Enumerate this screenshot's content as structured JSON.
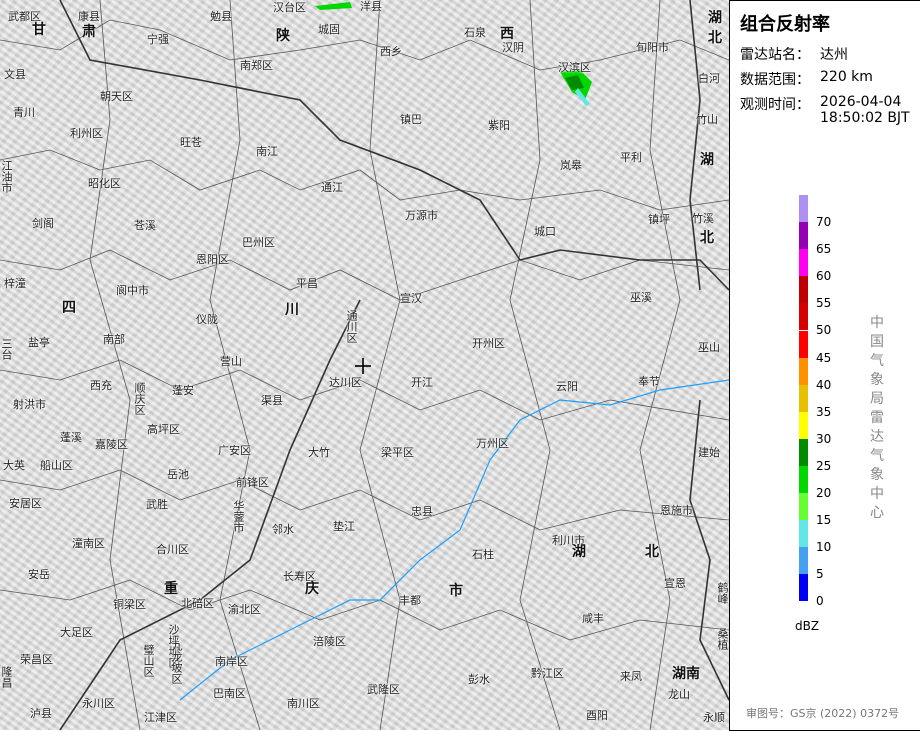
{
  "panel": {
    "title": "组合反射率",
    "station_label": "雷达站名：",
    "station": "达州",
    "range_label": "数据范围：",
    "range": "220 km",
    "time_label": "观测时间：",
    "date": "2026-04-04",
    "time": "18:50:02 BJT",
    "organization": "中国气象局雷达气象中心",
    "approval": "审图号：GS京 (2022) 0372号"
  },
  "legend": {
    "unit": "dBZ",
    "ticks": [
      "70",
      "65",
      "60",
      "55",
      "50",
      "45",
      "40",
      "35",
      "30",
      "25",
      "20",
      "15",
      "10",
      "5",
      "0"
    ],
    "colors": [
      "#ad90f0",
      "#9600b4",
      "#ff00f0",
      "#c00000",
      "#d60000",
      "#ff0000",
      "#ff9000",
      "#e7c000",
      "#ffff00",
      "#008c00",
      "#00d800",
      "#66ff33",
      "#63e6e6",
      "#44a0f0",
      "#0000f6"
    ]
  },
  "map": {
    "center_icon": "radar-crosshair-icon",
    "places": [
      "武都区",
      "康县",
      "勉县",
      "汉台区",
      "洋县",
      "甘",
      "肃",
      "宁强",
      "陕",
      "城固",
      "石泉",
      "西",
      "汉阴",
      "旬阳市",
      "湖",
      "北",
      "文县",
      "南郑区",
      "西乡",
      "汉滨区",
      "白河",
      "青川",
      "朝天区",
      "镇巴",
      "紫阳",
      "竹山",
      "利州区",
      "旺苍",
      "南江",
      "岚皋",
      "平利",
      "湖",
      "江油市",
      "昭化区",
      "通江",
      "剑阁",
      "苍溪",
      "万源市",
      "城口",
      "镇坪",
      "竹溪",
      "北",
      "巴州区",
      "恩阳区",
      "平昌",
      "梓潼",
      "阆中市",
      "四",
      "川",
      "仪陇",
      "宣汉",
      "巫溪",
      "通川区",
      "盐亭",
      "南部",
      "开州区",
      "巫山",
      "三台",
      "营山",
      "达川区",
      "开江",
      "云阳",
      "奉节",
      "西充",
      "顺庆区",
      "蓬安",
      "渠县",
      "射洪市",
      "高坪区",
      "蓬溪",
      "嘉陵区",
      "广安区",
      "大竹",
      "梁平区",
      "万州区",
      "建始",
      "大英",
      "船山区",
      "岳池",
      "前锋区",
      "安居区",
      "武胜",
      "华蓥市",
      "邻水",
      "垫江",
      "忠县",
      "恩施市",
      "潼南区",
      "合川区",
      "石柱",
      "利川市",
      "湖",
      "北",
      "安岳",
      "长寿区",
      "宣恩",
      "鹤峰",
      "重",
      "庆",
      "市",
      "铜梁区",
      "北碚区",
      "渝北区",
      "丰都",
      "大足区",
      "沙坪坝区",
      "涪陵区",
      "咸丰",
      "桑植",
      "荣昌区",
      "璧山区",
      "九龙坡区",
      "南岸区",
      "隆昌",
      "永川区",
      "巴南区",
      "武隆区",
      "彭水",
      "黔江区",
      "来凤",
      "湖南",
      "龙山",
      "泸县",
      "江津区",
      "南川区",
      "酉阳",
      "永顺"
    ]
  }
}
